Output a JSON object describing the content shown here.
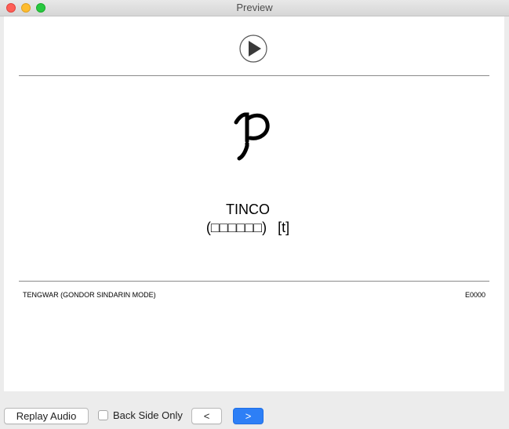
{
  "window": {
    "title": "Preview"
  },
  "card": {
    "icons": {
      "play": "play-circle-icon",
      "glyph": "tengwar-tinco-glyph"
    },
    "letter_name": "TINCO",
    "transliteration_open": "(",
    "transliteration_unrendered": "□□□□□□",
    "transliteration_close": ")",
    "sound": "[t]",
    "deck_name": "TENGWAR (GONDOR SINDARIN MODE)",
    "card_id": "E0000"
  },
  "controls": {
    "replay_label": "Replay Audio",
    "back_side_only_label": "Back Side Only",
    "back_side_only_checked": false,
    "prev_label": "<",
    "next_label": ">"
  },
  "colors": {
    "next_button": "#2d7ff6",
    "card_background": "#ffffff",
    "window_background": "#ececec"
  }
}
